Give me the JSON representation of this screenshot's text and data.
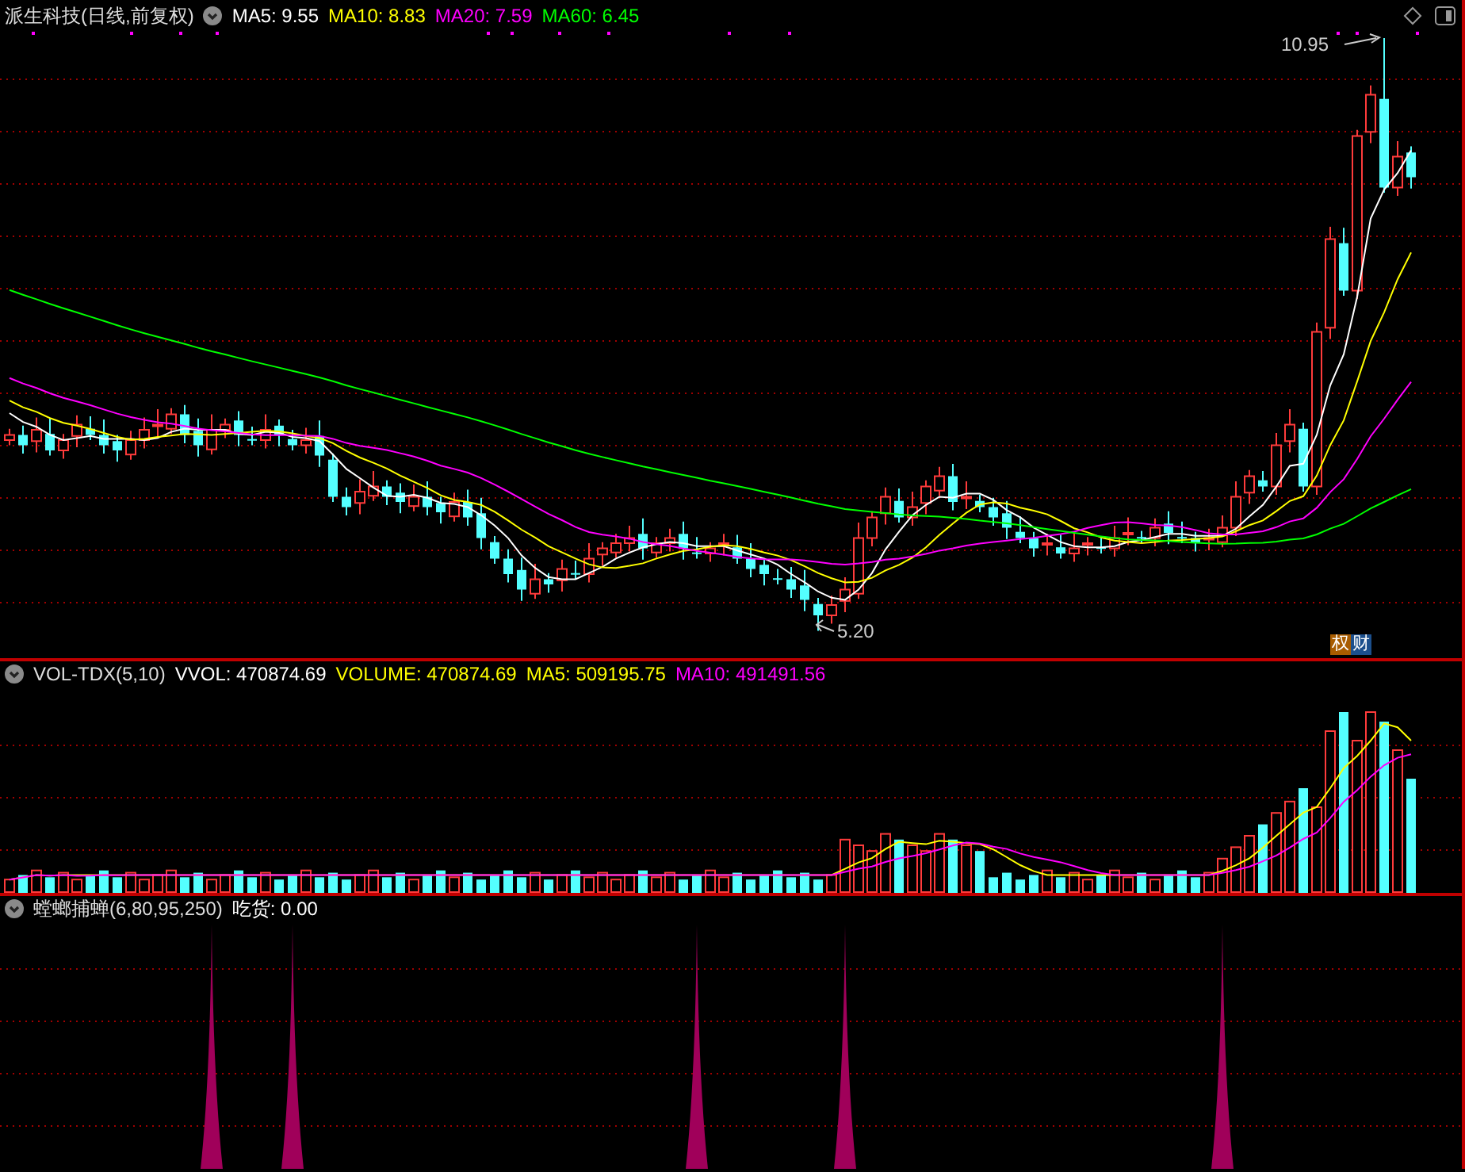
{
  "price_panel": {
    "title": "派生科技(日线,前复权)",
    "indicators": [
      {
        "label": "MA5: 9.55",
        "color": "#ffffff"
      },
      {
        "label": "MA10: 8.83",
        "color": "#ffff00"
      },
      {
        "label": "MA20: 7.59",
        "color": "#ff00ff"
      },
      {
        "label": "MA60: 6.45",
        "color": "#00ff00"
      }
    ],
    "high_label": "10.95",
    "low_label": "5.20",
    "badge": [
      {
        "text": "权",
        "color": "#a85c00"
      },
      {
        "text": "财",
        "color": "#1c4f8c"
      }
    ]
  },
  "volume_panel": {
    "title": "VOL-TDX(5,10)",
    "values": [
      {
        "label": "VVOL: 470874.69",
        "color": "#ffffff"
      },
      {
        "label": "VOLUME: 470874.69",
        "color": "#ffff00"
      },
      {
        "label": "MA5: 509195.75",
        "color": "#ffff00"
      },
      {
        "label": "MA10: 491491.56",
        "color": "#ff00ff"
      }
    ]
  },
  "indicator_panel": {
    "title": "螳螂捕蝉(6,80,95,250)",
    "values": [
      {
        "label": "吃货: 0.00",
        "color": "#ffffff"
      }
    ]
  }
}
